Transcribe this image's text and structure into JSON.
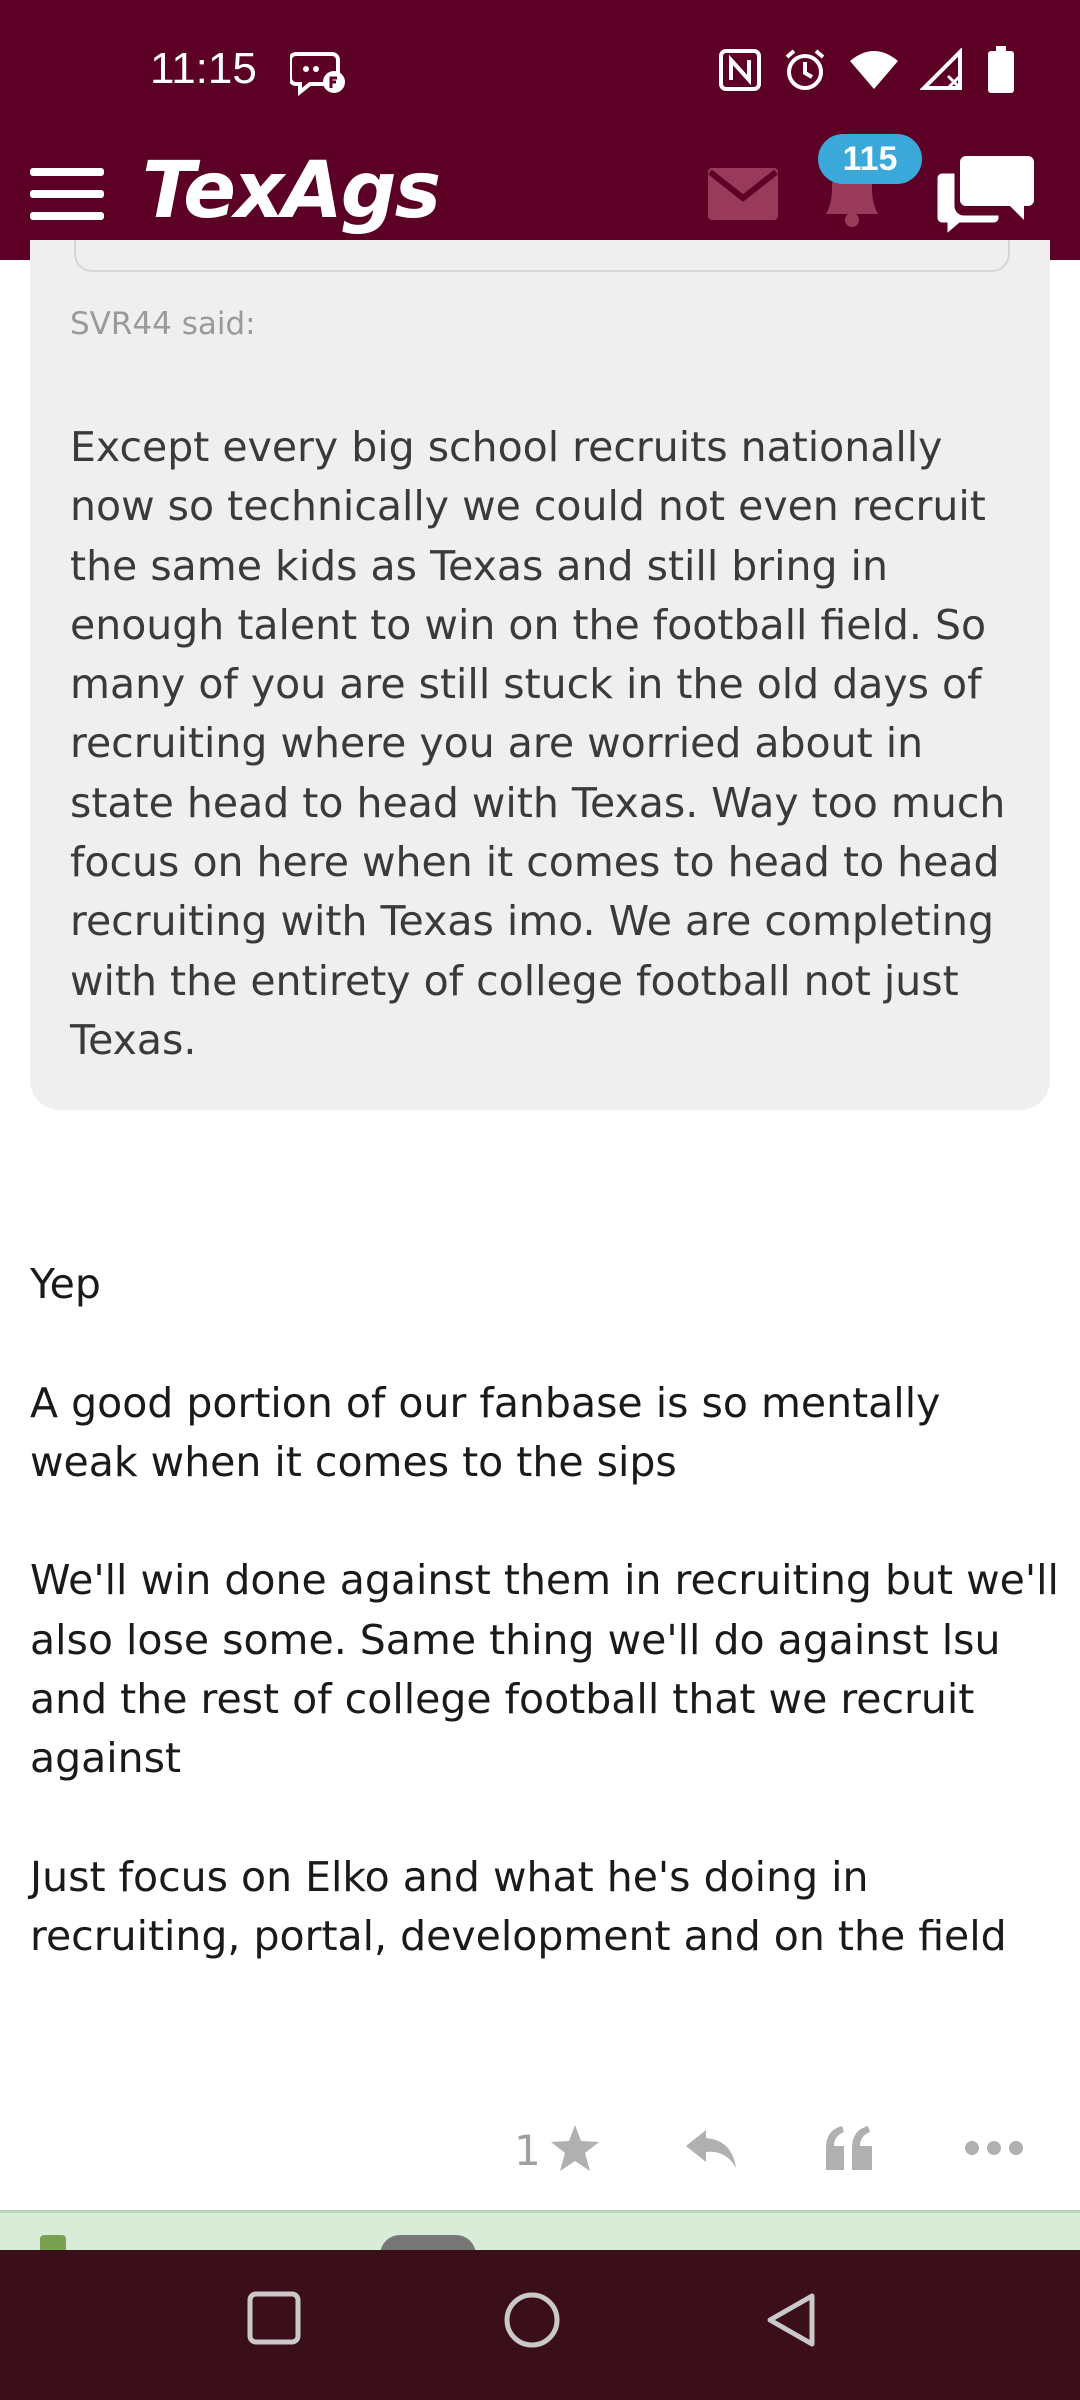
{
  "status_bar": {
    "time": "11:15",
    "icons": [
      "messenger-icon",
      "nfc-icon",
      "alarm-icon",
      "wifi-icon",
      "signal-icon",
      "battery-icon"
    ]
  },
  "app_bar": {
    "logo": "TexAgs",
    "notification_count": "115",
    "colors": {
      "maroon": "#5c0025",
      "badge": "#3aa8d8"
    }
  },
  "quote": {
    "author": "SVR44 said:",
    "text": "Except every big school recruits nationally now so technically we could not even recruit the same kids as Texas and still bring in enough talent to win on the football field. So many of you are still stuck in the old days of recruiting where you are worried about in state head to head with Texas. Way too much focus on here when it comes to head to head recruiting with Texas imo. We are completing with the entirety of college football not just Texas."
  },
  "post": {
    "paragraphs": [
      "Yep",
      "A good portion of our fanbase is so mentally weak when it comes to the sips",
      "We'll win done against them in recruiting but we'll also lose some. Same thing we'll do against lsu and the rest of college football that we recruit against",
      "Just focus on Elko and what he's doing in recruiting, portal, development and on the field"
    ]
  },
  "actions": {
    "like_count": "1"
  }
}
